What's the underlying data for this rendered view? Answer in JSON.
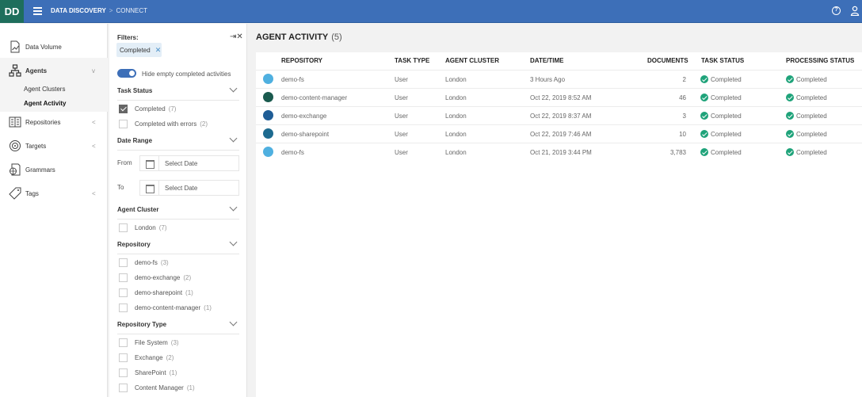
{
  "topbar": {
    "logo": "DD",
    "breadcrumb": [
      "DATA DISCOVERY",
      "CONNECT"
    ],
    "breadcrumb_separator": ">"
  },
  "sidebar": {
    "items": [
      {
        "label": "Data Volume",
        "icon": "chart-document-icon"
      },
      {
        "label": "Agents",
        "icon": "hierarchy-icon",
        "expanded": true,
        "chevron": "v"
      },
      {
        "label": "Repositories",
        "icon": "repository-icon",
        "chevron": "<"
      },
      {
        "label": "Targets",
        "icon": "target-icon",
        "chevron": "<"
      },
      {
        "label": "Grammars",
        "icon": "grammar-icon"
      },
      {
        "label": "Tags",
        "icon": "tag-icon",
        "chevron": "<"
      }
    ],
    "sub_items": [
      {
        "label": "Agent Clusters",
        "active": false
      },
      {
        "label": "Agent Activity",
        "active": true
      }
    ]
  },
  "filters": {
    "title": "Filters:",
    "close": "⇥✕",
    "chips": [
      {
        "label": "Completed",
        "remove": "✕"
      }
    ],
    "toggle": {
      "label": "Hide empty completed activities",
      "on": true
    },
    "task_status": {
      "title": "Task Status",
      "options": [
        {
          "label": "Completed",
          "count": "(7)",
          "checked": true
        },
        {
          "label": "Completed with errors",
          "count": "(2)",
          "checked": false
        }
      ]
    },
    "date_range": {
      "title": "Date Range",
      "from_label": "From",
      "to_label": "To",
      "from_placeholder": "Select Date",
      "to_placeholder": "Select Date"
    },
    "agent_cluster": {
      "title": "Agent Cluster",
      "options": [
        {
          "label": "London",
          "count": "(7)"
        }
      ]
    },
    "repository": {
      "title": "Repository",
      "options": [
        {
          "label": "demo-fs",
          "count": "(3)"
        },
        {
          "label": "demo-exchange",
          "count": "(2)"
        },
        {
          "label": "demo-sharepoint",
          "count": "(1)"
        },
        {
          "label": "demo-content-manager",
          "count": "(1)"
        }
      ]
    },
    "repository_type": {
      "title": "Repository Type",
      "options": [
        {
          "label": "File System",
          "count": "(3)"
        },
        {
          "label": "Exchange",
          "count": "(2)"
        },
        {
          "label": "SharePoint",
          "count": "(1)"
        },
        {
          "label": "Content Manager",
          "count": "(1)"
        }
      ]
    }
  },
  "main": {
    "title": "AGENT ACTIVITY",
    "count": "(5)",
    "columns": [
      "REPOSITORY",
      "TASK TYPE",
      "AGENT CLUSTER",
      "DATE/TIME",
      "DOCUMENTS",
      "TASK STATUS",
      "PROCESSING STATUS"
    ],
    "rows": [
      {
        "repo": "demo-fs",
        "repo_type": "file-system",
        "icon_color": "#4fb0e0",
        "task_type": "User",
        "cluster": "London",
        "datetime": "3 Hours Ago",
        "documents": "2",
        "task_status": "Completed",
        "processing_status": "Completed"
      },
      {
        "repo": "demo-content-manager",
        "repo_type": "content-manager",
        "icon_color": "#1a5a4e",
        "task_type": "User",
        "cluster": "London",
        "datetime": "Oct 22, 2019 8:52 AM",
        "documents": "46",
        "task_status": "Completed",
        "processing_status": "Completed"
      },
      {
        "repo": "demo-exchange",
        "repo_type": "exchange",
        "icon_color": "#1f5d96",
        "task_type": "User",
        "cluster": "London",
        "datetime": "Oct 22, 2019 8:37 AM",
        "documents": "3",
        "task_status": "Completed",
        "processing_status": "Completed"
      },
      {
        "repo": "demo-sharepoint",
        "repo_type": "sharepoint",
        "icon_color": "#1d6a8f",
        "task_type": "User",
        "cluster": "London",
        "datetime": "Oct 22, 2019 7:46 AM",
        "documents": "10",
        "task_status": "Completed",
        "processing_status": "Completed"
      },
      {
        "repo": "demo-fs",
        "repo_type": "file-system",
        "icon_color": "#4fb0e0",
        "task_type": "User",
        "cluster": "London",
        "datetime": "Oct 21, 2019 3:44 PM",
        "documents": "3,783",
        "task_status": "Completed",
        "processing_status": "Completed"
      }
    ]
  },
  "colors": {
    "topbar": "#3d6fb8",
    "logo_bg": "#1e6e5c",
    "status_success": "#1fa37a"
  }
}
